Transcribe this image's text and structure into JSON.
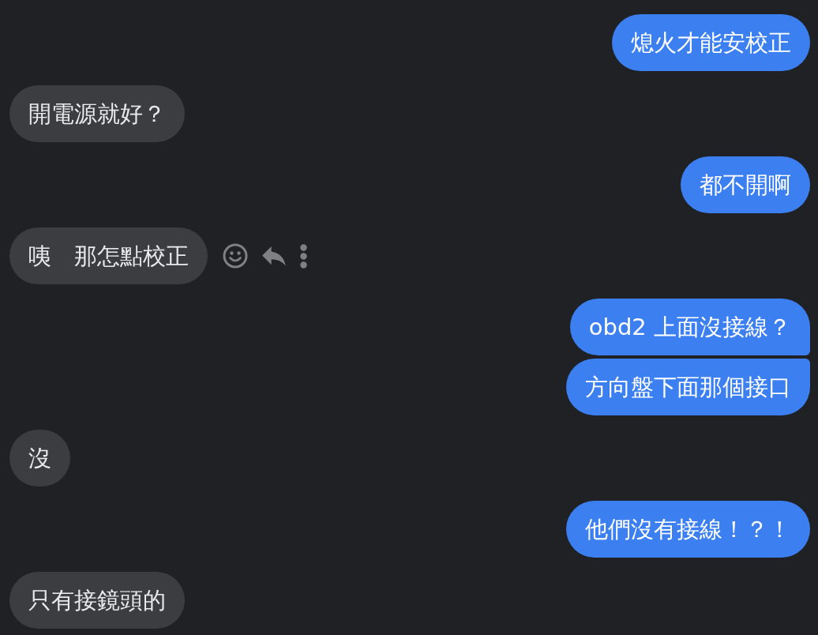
{
  "conversation": {
    "groups": [
      {
        "kind": "sent",
        "messages": [
          {
            "text": "熄火才能安校正",
            "actions_shown": false
          }
        ]
      },
      {
        "kind": "received",
        "messages": [
          {
            "text": "開電源就好？",
            "actions_shown": false
          }
        ]
      },
      {
        "kind": "sent",
        "messages": [
          {
            "text": "都不開啊",
            "actions_shown": false
          }
        ]
      },
      {
        "kind": "received",
        "messages": [
          {
            "text": "咦　那怎點校正",
            "actions_shown": true
          }
        ]
      },
      {
        "kind": "sent",
        "messages": [
          {
            "text": "obd2 上面沒接線？",
            "actions_shown": false
          },
          {
            "text": "方向盤下面那個接口",
            "actions_shown": false
          }
        ]
      },
      {
        "kind": "received",
        "messages": [
          {
            "text": "沒",
            "actions_shown": false
          }
        ]
      },
      {
        "kind": "sent",
        "messages": [
          {
            "text": "他們沒有接線！？！",
            "actions_shown": false
          }
        ]
      },
      {
        "kind": "received",
        "messages": [
          {
            "text": "只有接鏡頭的",
            "actions_shown": false
          }
        ]
      }
    ]
  }
}
